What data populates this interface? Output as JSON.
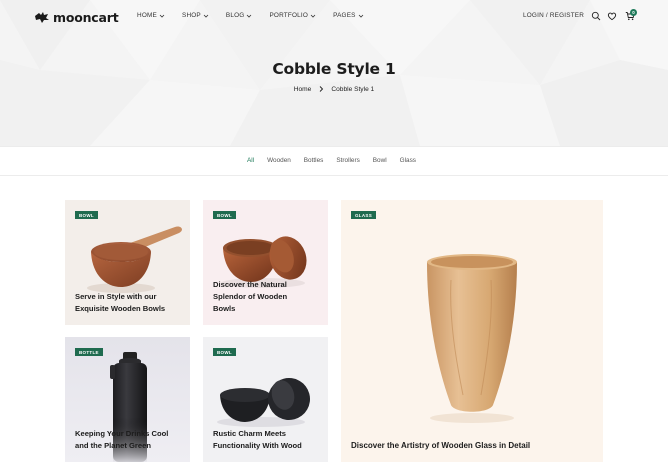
{
  "brand": {
    "name": "mooncart"
  },
  "nav": {
    "items": [
      {
        "label": "HOME"
      },
      {
        "label": "SHOP"
      },
      {
        "label": "BLOG"
      },
      {
        "label": "PORTFOLIO"
      },
      {
        "label": "PAGES"
      }
    ],
    "login_label": "LOGIN / REGISTER",
    "cart_count": "0"
  },
  "hero": {
    "title": "Cobble Style 1",
    "breadcrumb": {
      "home": "Home",
      "current": "Cobble Style 1"
    }
  },
  "filters": [
    "All",
    "Wooden",
    "Bottles",
    "Strollers",
    "Bowl",
    "Glass"
  ],
  "posts": [
    {
      "tag": "BOWL",
      "title_lines": [
        "Serve in Style with our",
        "Exquisite Wooden Bowls"
      ]
    },
    {
      "tag": "BOWL",
      "title_lines": [
        "Discover the Natural",
        "Splendor of Wooden",
        "Bowls"
      ]
    },
    {
      "tag": "GLASS",
      "title_lines": [
        "Discover the Artistry of Wooden Glass in Detail"
      ]
    },
    {
      "tag": "BOTTLE",
      "title_lines": [
        "Keeping Your Drinks Cool",
        "and the Planet Green"
      ]
    },
    {
      "tag": "BOWL",
      "title_lines": [
        "Rustic Charm Meets",
        "Functionality With Wood"
      ]
    }
  ],
  "colors": {
    "accent": "#1f7a5a",
    "tag_bg": "#1f6b4f",
    "hero_bg": "#f4f4f4"
  },
  "icons": [
    "search-icon",
    "heart-icon",
    "cart-icon",
    "chevron-down-icon",
    "chevron-right-icon",
    "logo-mark-icon"
  ]
}
